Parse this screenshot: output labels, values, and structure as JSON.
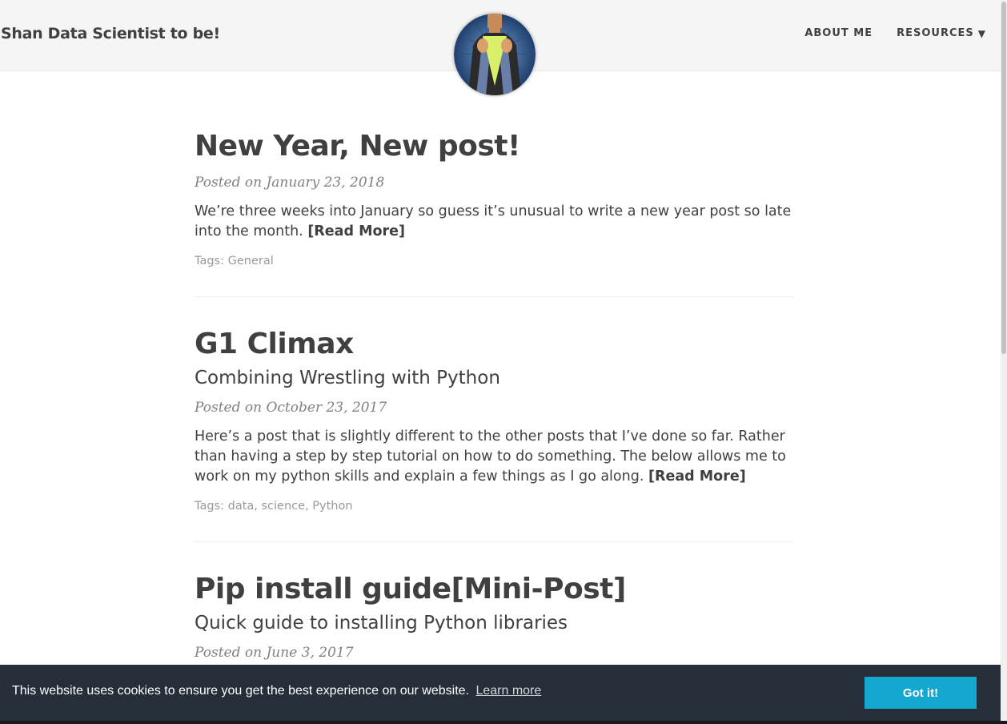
{
  "header": {
    "brand": "Shan Data Scientist to be!",
    "nav": [
      {
        "label": "ABOUT ME"
      },
      {
        "label": "RESOURCES",
        "caret": "▼"
      }
    ]
  },
  "posts": [
    {
      "title": "New Year, New post!",
      "meta": "Posted on January 23, 2018",
      "excerpt": "We’re three weeks into January so guess it’s unusual to write a new year post so late into the month.",
      "read_more": "[Read More]",
      "tags_label": "Tags:",
      "tags": [
        "General"
      ]
    },
    {
      "title": "G1 Climax",
      "subtitle": "Combining Wrestling with Python",
      "meta": "Posted on October 23, 2017",
      "excerpt": "Here’s a post that is slightly different to the other posts that I’ve done so far. Rather than having a step by step tutorial on how to do something. The below allows me to work on my python skills and explain a few things as I go along.",
      "read_more": "[Read More]",
      "tags_label": "Tags:",
      "tags": [
        "data",
        "science",
        "Python"
      ]
    },
    {
      "title": "Pip install guide[Mini-Post]",
      "subtitle": "Quick guide to installing Python libraries",
      "meta": "Posted on June 3, 2017"
    }
  ],
  "cookie": {
    "message": "This website uses cookies to ensure you get the best experience on our website.",
    "learn_more": "Learn more",
    "button": "Got it!"
  },
  "colors": {
    "text": "#404040",
    "meta": "#808080",
    "tags": "#999999",
    "cookie_bg": "#252e39",
    "cookie_button": "#14a7d0"
  }
}
